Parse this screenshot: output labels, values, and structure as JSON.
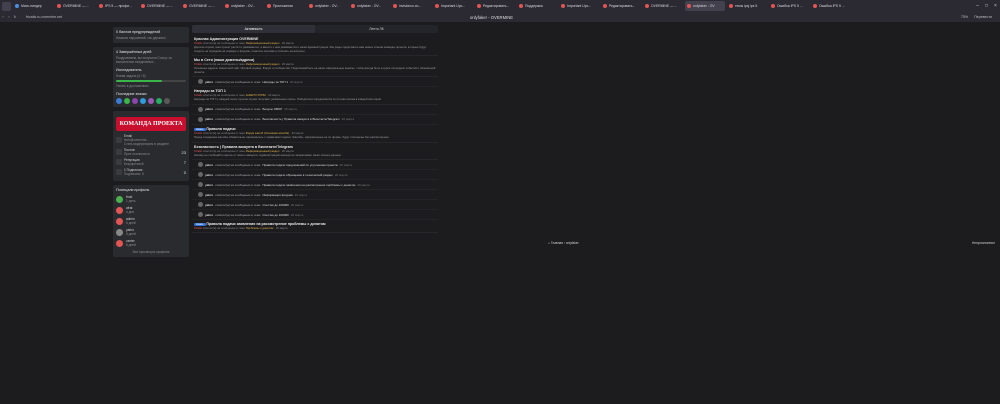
{
  "browser": {
    "tabs": [
      {
        "label": "Мисс-пиндер",
        "color": "#4a90e2"
      },
      {
        "label": "OVERMINE — ...",
        "color": "#e25555"
      },
      {
        "label": "IPS 5 — профи...",
        "color": "#e25555"
      },
      {
        "label": "OVERMINE — ...",
        "color": "#e25555"
      },
      {
        "label": "OVERMINE — ...",
        "color": "#e25555"
      },
      {
        "label": "onlyfaker - OV...",
        "color": "#e25555"
      },
      {
        "label": "Приложения",
        "color": "#e25555"
      },
      {
        "label": "onlyfaker - OV...",
        "color": "#e25555"
      },
      {
        "label": "onlyfaker - OV...",
        "color": "#e25555"
      },
      {
        "label": "invisionco.co...",
        "color": "#e25555"
      },
      {
        "label": "Important Upc...",
        "color": "#e25555"
      },
      {
        "label": "Редактировать...",
        "color": "#e25555"
      },
      {
        "label": "Поддержка",
        "color": "#e25555"
      },
      {
        "label": "Important Upc...",
        "color": "#e25555"
      },
      {
        "label": "Редактировать...",
        "color": "#e25555"
      },
      {
        "label": "OVERMINE — ...",
        "color": "#e25555"
      },
      {
        "label": "onlyfaker - OV",
        "color": "#e25555",
        "active": true
      },
      {
        "label": "темы ipsj ips 5",
        "color": "#e25555"
      },
      {
        "label": "Ошибка IPS 5 ...",
        "color": "#e25555"
      },
      {
        "label": "Ошибка IPS 5 ...",
        "color": "#e25555"
      }
    ],
    "url": "frizalis.ru.overmine.net",
    "page_title": "onlyfaker - OVERMINE",
    "zoom": "75%",
    "translate_label": "Перевести"
  },
  "sidebar": {
    "warn_title": "0 баллов предупреждений",
    "warn_sub": "Никаких нарушений, так держать!",
    "days_title": "4 Завершённых дней",
    "days_sub": "Поздравляем, вы получили Статус за выполнение ежедневных...",
    "exp_title": "Исследователь",
    "exp_sub": "Новая задача (4 / 6)",
    "exp_note": "Узнать в достижениях",
    "exp_progress": 0.66,
    "last_badges_title": "Последние значки",
    "badge_colors": [
      "#3a7bd5",
      "#39b54a",
      "#8e44ad",
      "#2d9cdb",
      "#9b59b6",
      "#27ae60",
      "#5a5a5a"
    ],
    "banner": "КОМАНДА ПРОЕКТА",
    "email_label": "Email",
    "email_value": "tech@overmine...",
    "email_note": "Стать модератором в разделе",
    "posts_label": "Постов",
    "posts_sub": "Приз лояльности",
    "posts_value": "23",
    "rep_label": "Репутация",
    "rep_sub": "Безупречный",
    "rep_value": "7",
    "subs_label": "1 Подписчик",
    "subs_sub": "Подписано: 5",
    "subs_value": "0",
    "people_title": "Посещали профиль",
    "people": [
      {
        "name": "frost",
        "when": "1 день",
        "color": "#4caf50"
      },
      {
        "name": "afrat",
        "when": "4 дня",
        "color": "#e25555"
      },
      {
        "name": "admin",
        "when": "5 дней",
        "color": "#e25555"
      },
      {
        "name": "yabro",
        "when": "5 дней",
        "color": "#888888"
      },
      {
        "name": "vaxter",
        "when": "6 дней",
        "color": "#e25555"
      }
    ],
    "people_more": "Все просмотры профиля"
  },
  "main": {
    "tabs": [
      "Активность",
      "Лента ЛК"
    ],
    "entries": [
      {
        "type": "post",
        "title": "Красная Администрация OVERMINE",
        "meta_user": "frizalis",
        "meta_text": "ответил(а) на сообщение в теме",
        "meta_topic": "Информационный раздел",
        "date": "20 марта",
        "body": "Дорогие игроки, наш проект растёт и развивается, а вместе с ним развивается и наша Администрация. Мы рады представить вам новых членов команды проекта, которые будут следить за порядком на сервере и форуме, помогать игрокам и отвечать на вопросы."
      },
      {
        "type": "post",
        "title": "Мы в Сети (наши домены/адреса)",
        "meta_user": "frizalis",
        "meta_text": "ответил(а) на сообщение в теме",
        "meta_topic": "Информационный раздел",
        "date": "20 марта",
        "body": "Основные адреса: Новостной сайт, Игровой сервер, Форум и сообщество. Подписывайтесь на наши официальные каналы, чтобы всегда быть в курсе последних событий и обновлений проекта."
      },
      {
        "type": "act",
        "user": "yabro",
        "text": "ответил(а) на сообщение в теме",
        "topic": "Награды за ТОП 1",
        "time": "20 марта"
      },
      {
        "type": "post",
        "title": "Награды за ТОП 1",
        "meta_user": "frizalis",
        "meta_text": "ответил(а) на сообщение в теме",
        "meta_topic": "АНКЕТО-ТРИМ",
        "date": "20 марта",
        "body": "Награды за ТОП 1: каждый сезон лучшие игроки получают уникальные призы. Победители определяются по итогам сезона в каждой категории."
      },
      {
        "type": "act",
        "user": "yabro",
        "text": "ответил(а) на сообщение в теме",
        "topic": "Бонусы ОВОР",
        "time": "20 марта"
      },
      {
        "type": "act",
        "user": "yabro",
        "text": "ответил(а) на сообщение в теме",
        "topic": "Безопасность | Правила аккаунта в Вконтакте/Telegram",
        "time": "20 марта"
      },
      {
        "type": "post",
        "badge": "Новое",
        "title": "Правила подачи",
        "meta_user": "frizalis",
        "meta_text": "ответил(а) на сообщение в теме",
        "meta_topic": "Форум жалоб (Основная жалоба)",
        "date": "20 марта",
        "body": "Перед созданием жалобы обязательно ознакомьтесь с правилами подачи. Жалобы, оформленные не по форме, будут отклонены без рассмотрения."
      },
      {
        "type": "post",
        "title": "Безопасность | Правила аккаунта в Вконтакте/Telegram",
        "meta_user": "frizalis",
        "meta_text": "ответил(а) на сообщение в теме",
        "meta_topic": "Информационный раздел",
        "date": "20 марта",
        "body": "Никому не сообщайте пароль от своего аккаунта. Администрация никогда не запрашивает ваши личные данные."
      },
      {
        "type": "act",
        "user": "yabro",
        "text": "ответил(а) на сообщение в теме",
        "topic": "Правила подачи предложений по улучшению проекта",
        "time": "20 марта"
      },
      {
        "type": "act",
        "user": "yabro",
        "text": "ответил(а) на сообщение в теме",
        "topic": "Правила подачи обращения в технический раздел",
        "time": "20 марта"
      },
      {
        "type": "act",
        "user": "yabro",
        "text": "ответил(а) на сообщение в теме",
        "topic": "Правила подачи заявления на рассмотрение проблемы с донатом",
        "time": "20 марта"
      },
      {
        "type": "act",
        "user": "yabro",
        "text": "ответил(а) на сообщение в теме",
        "topic": "Информация форума",
        "time": "20 марта"
      },
      {
        "type": "act",
        "user": "yabro",
        "text": "ответил(а) на сообщение в теме",
        "topic": "Счетчик до 100000",
        "time": "20 марта"
      },
      {
        "type": "act",
        "user": "yabro",
        "text": "ответил(а) на сообщение в теме",
        "topic": "Счетчик до 100000",
        "time": "20 марта"
      },
      {
        "type": "post",
        "badge": "Новое",
        "title": "Правила подачи заявления на рассмотрение проблемы с донатом",
        "meta_user": "frizalis",
        "meta_text": "ответил(а) на сообщение в теме",
        "meta_topic": "Проблемы с донатом",
        "date": "20 марта",
        "body": ""
      }
    ]
  },
  "breadcrumb": {
    "home": "Главная",
    "current": "onlyfaker",
    "right": "Непрочитанное"
  }
}
